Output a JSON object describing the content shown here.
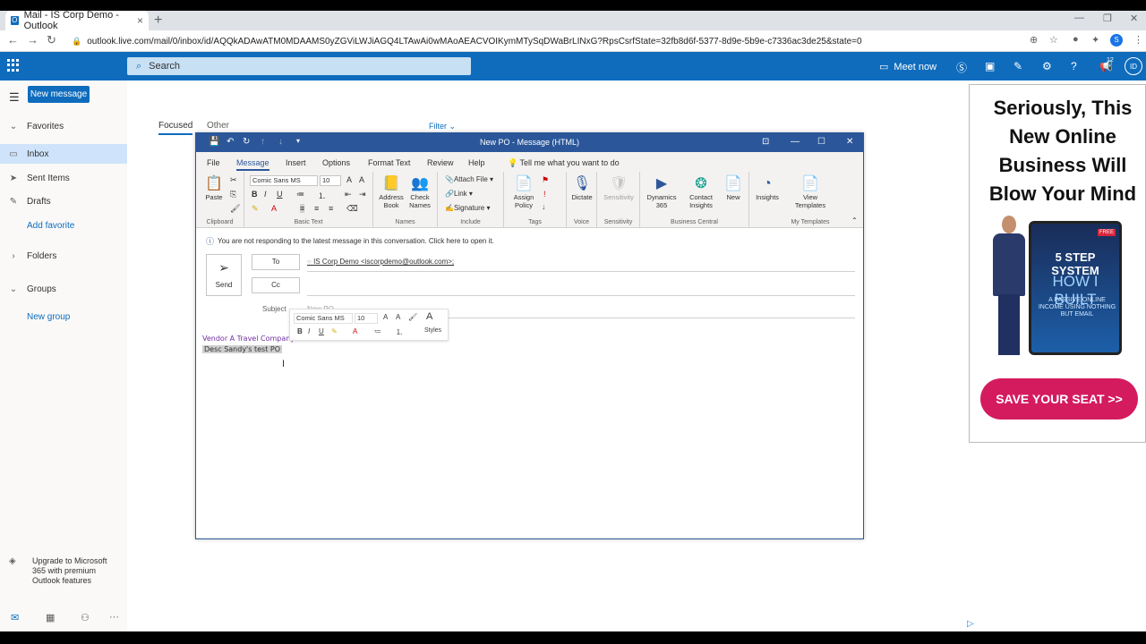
{
  "browser": {
    "tab_title": "Mail - IS Corp Demo - Outlook",
    "url": "outlook.live.com/mail/0/inbox/id/AQQkADAwATM0MDAAMS0yZGViLWJiAGQ4LTAwAi0wMAoAEACVOIKymMTySqDWaBrLINxG?RpsCsrfState=32fb8d6f-5377-8d9e-5b9e-c7336ac3de25&state=0",
    "profile_initial": "S"
  },
  "header": {
    "search_placeholder": "Search",
    "meet_now": "Meet now",
    "badge": "12",
    "avatar": "ID"
  },
  "sidebar": {
    "new_message": "New message",
    "items": [
      {
        "label": "Favorites",
        "icon": "chevron-down-icon"
      },
      {
        "label": "Inbox",
        "icon": "inbox-icon"
      },
      {
        "label": "Sent Items",
        "icon": "send-icon"
      },
      {
        "label": "Drafts",
        "icon": "pencil-icon"
      },
      {
        "label": "Add favorite"
      },
      {
        "label": "Folders",
        "icon": "chevron-right-icon"
      },
      {
        "label": "Groups",
        "icon": "chevron-down-icon"
      },
      {
        "label": "New group"
      }
    ],
    "upgrade": "Upgrade to Microsoft 365 with premium Outlook features"
  },
  "list": {
    "focused": "Focused",
    "other": "Other",
    "filter": "Filter"
  },
  "compose": {
    "title": "New PO  -  Message (HTML)",
    "menus": [
      "File",
      "Message",
      "Insert",
      "Options",
      "Format Text",
      "Review",
      "Help"
    ],
    "tell_me": "Tell me what you want to do",
    "ribbon": {
      "paste": "Paste",
      "font": "Comic Sans MS",
      "size": "10",
      "clipboard": "Clipboard",
      "basic_text": "Basic Text",
      "address_book": "Address Book",
      "check_names": "Check Names",
      "names": "Names",
      "attach_file": "Attach File",
      "link": "Link",
      "signature": "Signature",
      "include": "Include",
      "assign_policy": "Assign Policy",
      "tags": "Tags",
      "dictate": "Dictate",
      "voice": "Voice",
      "sensitivity": "Sensitivity",
      "sensitivity_group": "Sensitivity",
      "dynamics": "Dynamics 365",
      "contact_insights": "Contact Insights",
      "new": "New",
      "business_central": "Business Central",
      "insights": "Insights",
      "view_templates": "View Templates",
      "my_templates": "My Templates"
    },
    "info_bar": "You are not responding to the latest message in this conversation. Click here to open it.",
    "send": "Send",
    "to": "To",
    "cc": "Cc",
    "recipient": "IS Corp Demo <iscorpdemo@outlook.com>;",
    "subject_label": "Subject",
    "subject_value": "New PO",
    "body_line1": "Vendor A Travel Company",
    "body_line2": "Desc Sandy's test PO",
    "mini_toolbar": {
      "font": "Comic Sans MS",
      "size": "10",
      "styles": "Styles"
    }
  },
  "ad": {
    "headline": "Seriously, This New Online Business Will Blow Your Mind",
    "free": "FREE",
    "book_line1": "5 STEP SYSTEM",
    "book_line2": "HOW I BUILT",
    "book_line3": "A PASSIVE ONLINE INCOME USING NOTHING BUT EMAIL",
    "cta": "SAVE YOUR SEAT >>"
  }
}
